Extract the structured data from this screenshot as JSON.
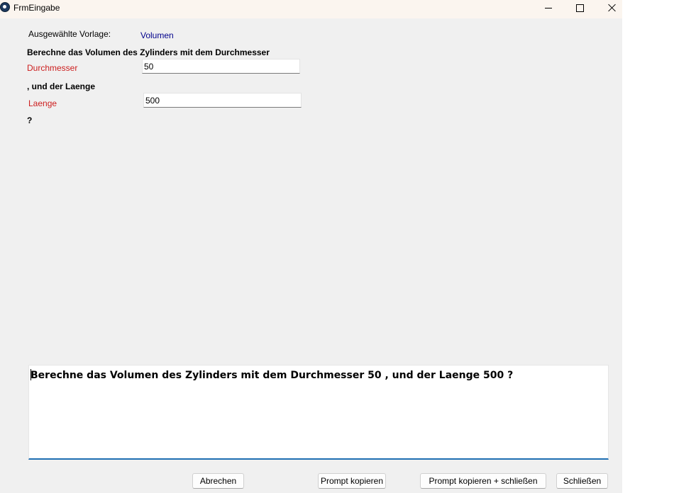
{
  "window": {
    "title": "FrmEingabe",
    "icon": "paw-icon"
  },
  "form": {
    "template_label": "Ausgewählte Vorlage:",
    "template_value": "Volumen",
    "sentence_part1": "Berechne das Volumen des Zylinders mit dem Durchmesser",
    "field1_label": "Durchmesser",
    "field1_value": "50",
    "sentence_part2": ", und der Laenge",
    "field2_label": "Laenge",
    "field2_value": "500",
    "sentence_end": "?"
  },
  "prompt": {
    "text": "Berechne das Volumen des Zylinders mit dem Durchmesser 50 , und der Laenge 500 ?"
  },
  "buttons": {
    "cancel": "Abrechen",
    "copy": "Prompt kopieren",
    "copy_close": "Prompt kopieren + schließen",
    "close": "Schließen"
  },
  "colors": {
    "label_red": "#cc1e1e",
    "value_blue": "#00008b",
    "focus_underline": "#1f6fb2",
    "window_bg": "#f0f0f0"
  }
}
